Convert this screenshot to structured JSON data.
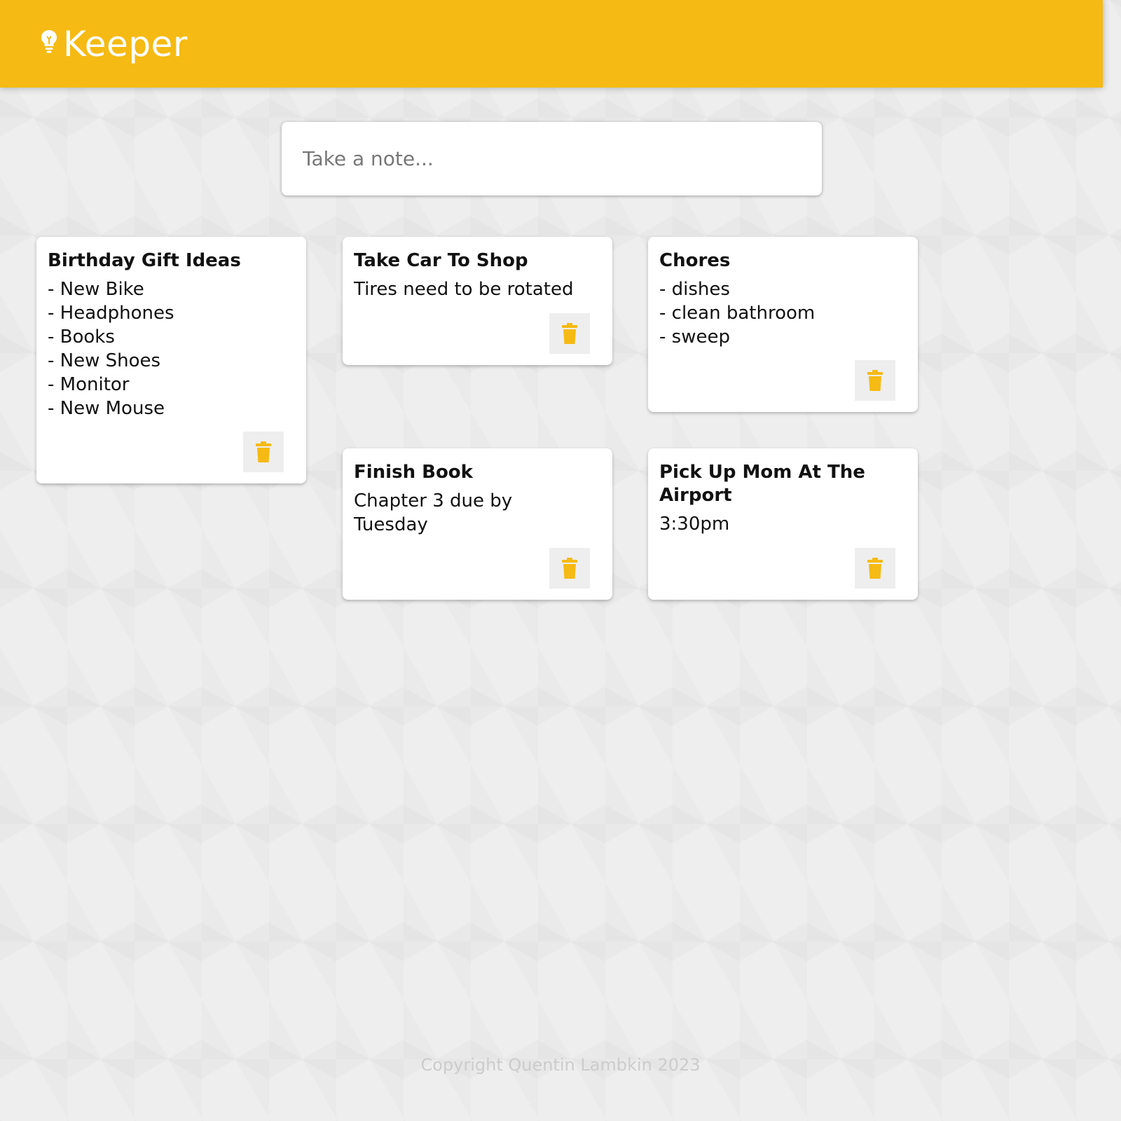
{
  "header": {
    "title": "Keeper",
    "icon": "lightbulb-icon"
  },
  "create_area": {
    "placeholder": "Take a note..."
  },
  "notes": [
    {
      "title": "Birthday Gift Ideas",
      "content": "- New Bike\n- Headphones\n- Books\n- New Shoes\n- Monitor\n- New Mouse",
      "delete_icon": "trash-icon"
    },
    {
      "title": "Take Car To Shop",
      "content": "Tires need to be rotated",
      "delete_icon": "trash-icon"
    },
    {
      "title": "Chores",
      "content": "- dishes\n- clean bathroom\n- sweep",
      "delete_icon": "trash-icon"
    },
    {
      "title": "Finish Book",
      "content": "Chapter 3 due by\nTuesday",
      "delete_icon": "trash-icon"
    },
    {
      "title": "Pick Up Mom At The Airport",
      "content": "3:30pm",
      "delete_icon": "trash-icon"
    }
  ],
  "footer": {
    "text": "Copyright Quentin Lambkin 2023"
  },
  "colors": {
    "accent": "#f5ba13",
    "background": "#eeeeee",
    "card": "#ffffff"
  }
}
